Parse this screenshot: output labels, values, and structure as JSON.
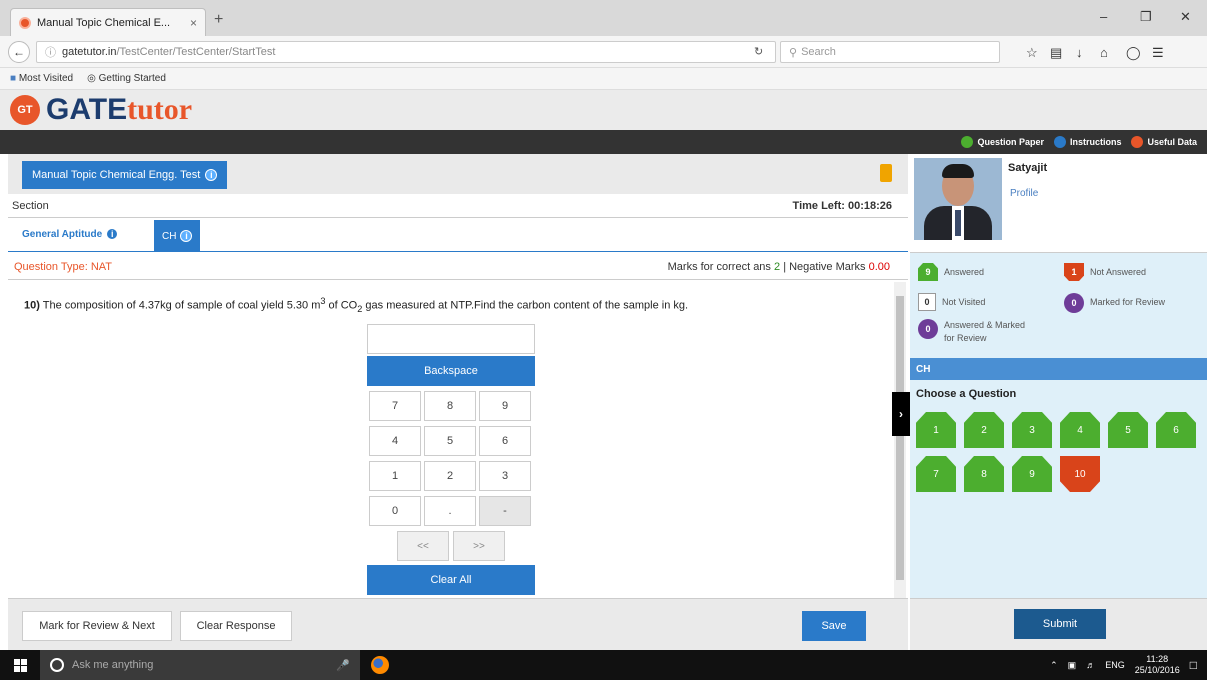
{
  "browser": {
    "tab_title": "Manual Topic Chemical E...",
    "tab_close": "×",
    "new_tab": "+",
    "url_host": "gatetutor.in",
    "url_path": "/TestCenter/TestCenter/StartTest",
    "search_placeholder": "Search",
    "bookmarks": [
      "Most Visited",
      "Getting Started"
    ]
  },
  "site": {
    "logo_badge": "GT",
    "logo_gate": "GATE",
    "logo_tutor": "tutor",
    "top_links": [
      {
        "label": "Question Paper",
        "color": "#4cae2f"
      },
      {
        "label": "Instructions",
        "color": "#2a7ac9"
      },
      {
        "label": "Useful Data",
        "color": "#e8562a"
      }
    ]
  },
  "test": {
    "name": "Manual Topic Chemical Engg. Test",
    "section_label": "Section",
    "time_left": "Time Left: 00:18:26",
    "sections": [
      "General Aptitude",
      "CH"
    ],
    "question_type_label": "Question Type: NAT",
    "marks_prefix": "Marks for correct ans",
    "marks_correct": "2",
    "marks_sep": "| Negative Marks",
    "marks_negative": "0.00",
    "question_number": "10)",
    "question_text_a": " The composition of 4.37kg of sample of coal yield 5.30 m",
    "question_sup": "3",
    "question_text_b": " of CO",
    "question_sub": "2",
    "question_text_c": " gas measured at NTP.Find the carbon content of the sample in kg."
  },
  "keypad": {
    "backspace": "Backspace",
    "rows": [
      [
        "7",
        "8",
        "9"
      ],
      [
        "4",
        "5",
        "6"
      ],
      [
        "1",
        "2",
        "3"
      ],
      [
        "0",
        ".",
        "-"
      ]
    ],
    "left_arrow": "<<",
    "right_arrow": ">>",
    "clear_all": "Clear All"
  },
  "actions": {
    "mark_review": "Mark for Review & Next",
    "clear_response": "Clear Response",
    "save": "Save",
    "submit": "Submit"
  },
  "profile": {
    "name": "Satyajit",
    "link": "Profile"
  },
  "legend": {
    "answered_count": "9",
    "answered": "Answered",
    "not_answered_count": "1",
    "not_answered": "Not Answered",
    "not_visited_count": "0",
    "not_visited": "Not Visited",
    "marked_count": "0",
    "marked": "Marked for Review",
    "ans_marked_count": "0",
    "ans_marked": "Answered & Marked for Review"
  },
  "palette": {
    "section": "CH",
    "choose": "Choose a Question",
    "questions": [
      {
        "n": "1",
        "status": "answered"
      },
      {
        "n": "2",
        "status": "answered"
      },
      {
        "n": "3",
        "status": "answered"
      },
      {
        "n": "4",
        "status": "answered"
      },
      {
        "n": "5",
        "status": "answered"
      },
      {
        "n": "6",
        "status": "answered"
      },
      {
        "n": "7",
        "status": "answered"
      },
      {
        "n": "8",
        "status": "answered"
      },
      {
        "n": "9",
        "status": "answered"
      },
      {
        "n": "10",
        "status": "not-answered"
      }
    ]
  },
  "taskbar": {
    "search": "Ask me anything",
    "lang": "ENG",
    "time": "11:28",
    "date": "25/10/2016"
  }
}
